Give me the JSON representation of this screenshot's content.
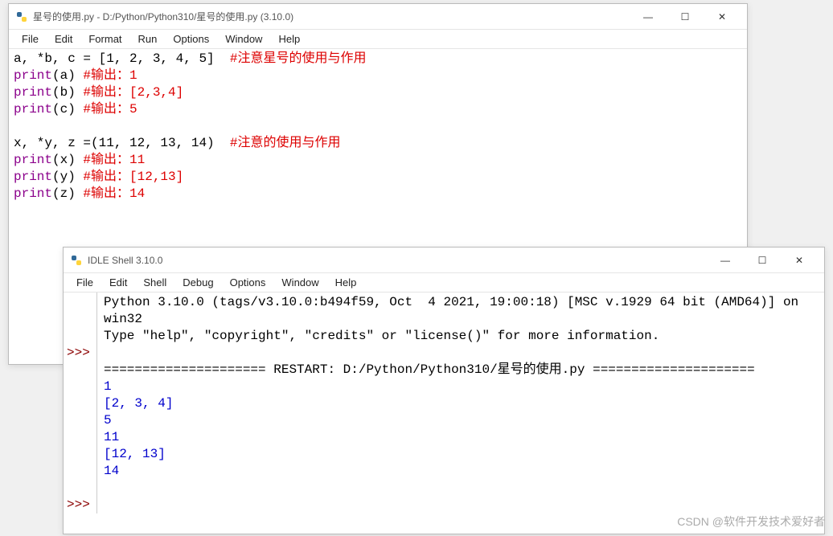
{
  "editor": {
    "title": "星号的使用.py - D:/Python/Python310/星号的使用.py (3.10.0)",
    "menu": [
      "File",
      "Edit",
      "Format",
      "Run",
      "Options",
      "Window",
      "Help"
    ],
    "code": {
      "l1_a": "a, *b, c = [1, 2, 3, 4, 5]  ",
      "l1_c": "#注意星号的使用与作用",
      "l2_p": "print",
      "l2_a": "(a) ",
      "l2_c": "#输出：1",
      "l3_a": "(b) ",
      "l3_c": "#输出：[2,3,4]",
      "l4_a": "(c) ",
      "l4_c": "#输出：5",
      "l5_a": "x, *y, z =(11, 12, 13, 14)  ",
      "l5_c": "#注意的使用与作用",
      "l6_a": "(x) ",
      "l6_c": "#输出：11",
      "l7_a": "(y) ",
      "l7_c": "#输出：[12,13]",
      "l8_a": "(z) ",
      "l8_c": "#输出：14"
    }
  },
  "shell": {
    "title": "IDLE Shell 3.10.0",
    "menu": [
      "File",
      "Edit",
      "Shell",
      "Debug",
      "Options",
      "Window",
      "Help"
    ],
    "prompt": ">>>",
    "banner1": "Python 3.10.0 (tags/v3.10.0:b494f59, Oct  4 2021, 19:00:18) [MSC v.1929 64 bit (AMD64)] on win32",
    "banner2": "Type \"help\", \"copyright\", \"credits\" or \"license()\" for more information.",
    "restart": "===================== RESTART: D:/Python/Python310/星号的使用.py =====================",
    "out": [
      "1",
      "[2, 3, 4]",
      "5",
      "11",
      "[12, 13]",
      "14"
    ]
  },
  "controls": {
    "min": "—",
    "max": "☐",
    "close": "✕"
  },
  "watermark": "CSDN @软件开发技术爱好者"
}
